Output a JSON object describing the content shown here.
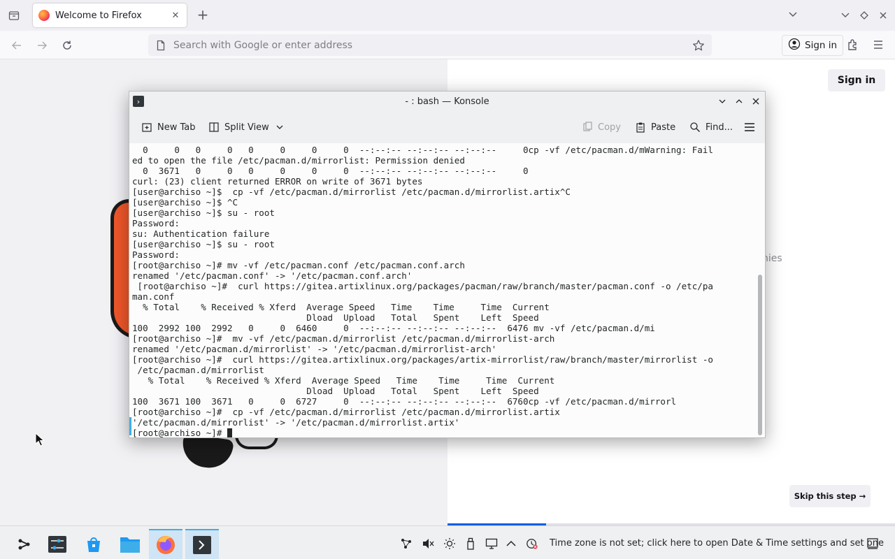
{
  "browser": {
    "tab": {
      "title": "Welcome to Firefox"
    },
    "urlbar": {
      "placeholder": "Search with Google or enter address",
      "value": ""
    },
    "toolbar": {
      "signin_label": "Sign in"
    }
  },
  "page": {
    "signin_label": "Sign in",
    "fragment_text": "nies",
    "skip_label": "Skip this step →",
    "progress": 0.22,
    "colors": {
      "progress": "#0061e0",
      "left_panel": "#f1f1f4"
    }
  },
  "konsole": {
    "title": "- : bash — Konsole",
    "toolbar": {
      "new_tab": "New Tab",
      "split_view": "Split View",
      "copy": "Copy",
      "paste": "Paste",
      "find": "Find..."
    },
    "lines": [
      "  0     0   0     0   0     0     0     0  --:--:-- --:--:-- --:--:--     0cp -vf /etc/pacman.d/mWarning: Fail",
      "ed to open the file /etc/pacman.d/mirrorlist: Permission denied",
      "  0  3671   0     0   0     0     0     0  --:--:-- --:--:-- --:--:--     0",
      "curl: (23) client returned ERROR on write of 3671 bytes",
      "[user@archiso ~]$  cp -vf /etc/pacman.d/mirrorlist /etc/pacman.d/mirrorlist.artix^C",
      "[user@archiso ~]$ ^C",
      "[user@archiso ~]$ su - root",
      "Password:",
      "su: Authentication failure",
      "[user@archiso ~]$ su - root",
      "Password:",
      "[root@archiso ~]# mv -vf /etc/pacman.conf /etc/pacman.conf.arch",
      "renamed '/etc/pacman.conf' -> '/etc/pacman.conf.arch'",
      " [root@archiso ~]#  curl https://gitea.artixlinux.org/packages/pacman/raw/branch/master/pacman.conf -o /etc/pa",
      "man.conf",
      "  % Total    % Received % Xferd  Average Speed   Time    Time     Time  Current",
      "                                 Dload  Upload   Total   Spent    Left  Speed",
      "100  2992 100  2992   0     0  6460     0  --:--:-- --:--:-- --:--:--  6476 mv -vf /etc/pacman.d/mi",
      "[root@archiso ~]#  mv -vf /etc/pacman.d/mirrorlist /etc/pacman.d/mirrorlist-arch",
      "renamed '/etc/pacman.d/mirrorlist' -> '/etc/pacman.d/mirrorlist-arch'",
      "[root@archiso ~]#  curl https://gitea.artixlinux.org/packages/artix-mirrorlist/raw/branch/master/mirrorlist -o",
      " /etc/pacman.d/mirrorlist",
      "   % Total    % Received % Xferd  Average Speed   Time    Time     Time  Current",
      "                                 Dload  Upload   Total   Spent    Left  Speed",
      "100  3671 100  3671   0     0  6727     0  --:--:-- --:--:-- --:--:--  6760cp -vf /etc/pacman.d/mirrorl",
      "[root@archiso ~]#  cp -vf /etc/pacman.d/mirrorlist /etc/pacman.d/mirrorlist.artix",
      "'/etc/pacman.d/mirrorlist' -> '/etc/pacman.d/mirrorlist.artix'"
    ],
    "prompt": "[root@archiso ~]# "
  },
  "taskbar": {
    "timezone_message": "Time zone is not set; click here to open Date & Time settings and set one",
    "icons": [
      "app-launcher-icon",
      "system-settings-icon",
      "discover-icon",
      "file-manager-icon",
      "firefox-icon",
      "konsole-icon"
    ]
  }
}
